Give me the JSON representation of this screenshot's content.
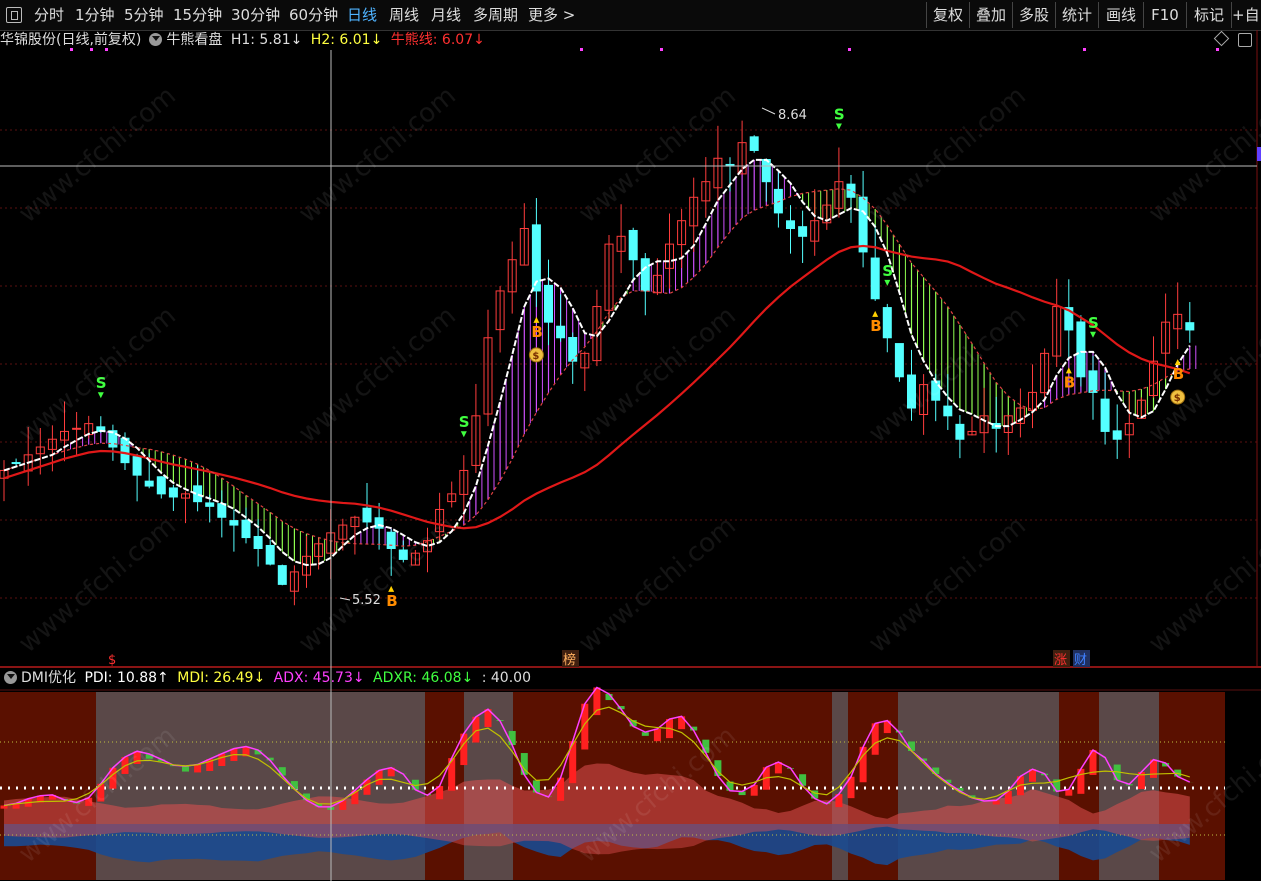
{
  "toolbar": {
    "periods": [
      "分时",
      "1分钟",
      "5分钟",
      "15分钟",
      "30分钟",
      "60分钟",
      "日线",
      "周线",
      "月线",
      "多周期",
      "更多 >"
    ],
    "active_period": "日线",
    "right_buttons": [
      "复权",
      "叠加",
      "多股",
      "统计",
      "画线",
      "F10",
      "标记",
      "+自"
    ]
  },
  "main_panel": {
    "stock_title": "华锦股份(日线,前复权)",
    "indicator_name": "牛熊看盘",
    "h1": "H1: 5.81↓",
    "h2": "H2: 6.01↓",
    "bull_bear": "牛熊线: 6.07↓",
    "high_label": "8.64",
    "low_label": "5.52",
    "signal_s": "S",
    "signal_b": "B",
    "money_icon": "$",
    "event_marks": [
      "$",
      "榜",
      "涨",
      "财"
    ]
  },
  "sub_panel": {
    "indicator_name": "DMI优化",
    "pdi": "PDI: 10.88↑",
    "mdi": "MDI: 26.49↓",
    "adx": "ADX: 45.73↓",
    "adxr": "ADXR: 46.08↓",
    "level": ": 40.00"
  },
  "watermark": "www.cfchi.com",
  "colors": {
    "up": "#ff3c3c",
    "down": "#54ffff",
    "ma_white": "#ffffff",
    "ma_red": "#e01818",
    "fill_magenta": "#d050ff",
    "fill_green": "#90ff50",
    "pdi": "#ffffff",
    "mdi": "#ffff00",
    "adx": "#ff40ff",
    "adxr": "#40ff40"
  }
}
